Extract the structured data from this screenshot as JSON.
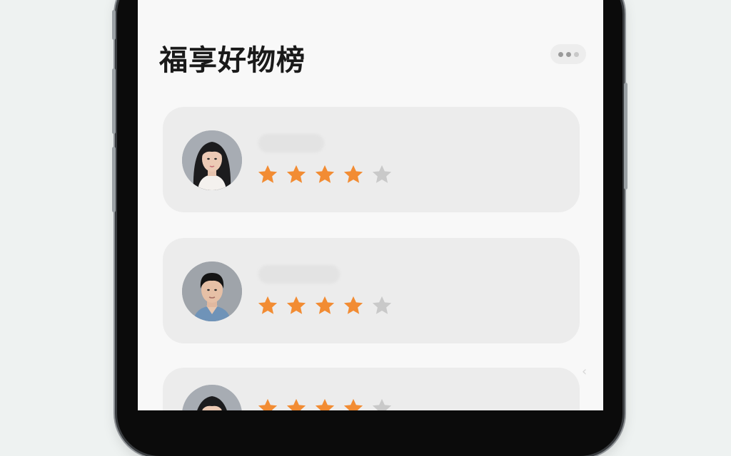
{
  "page": {
    "title": "福享好物榜"
  },
  "more_button": {
    "icon": "more-dots-icon"
  },
  "colors": {
    "star_filled": "#f28c33",
    "star_empty": "#c9c9c9",
    "card_bg": "#ececec",
    "title": "#1a1a1a"
  },
  "reviews": [
    {
      "username": "",
      "rating": 4,
      "max_rating": 5,
      "avatar": "female-avatar"
    },
    {
      "username": "",
      "rating": 4,
      "max_rating": 5,
      "avatar": "male-avatar"
    },
    {
      "username": "",
      "rating": 4,
      "max_rating": 5,
      "avatar": "female-avatar"
    }
  ]
}
